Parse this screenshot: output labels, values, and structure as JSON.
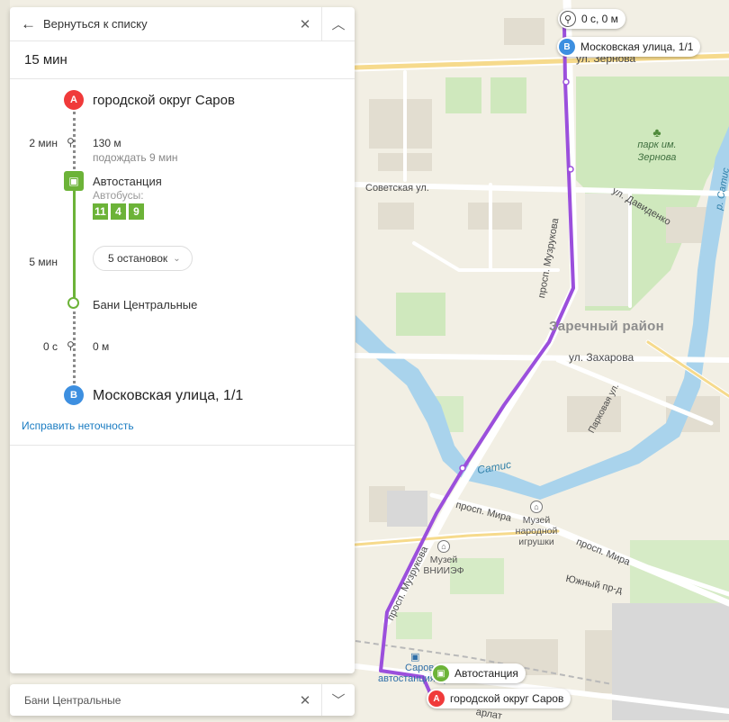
{
  "panel": {
    "back_label": "Вернуться к списку",
    "close_icon": "close-icon",
    "collapse_icon": "chevron-up-icon",
    "duration": "15 мин",
    "route": {
      "start_label": "A",
      "start_name": "городской округ Саров",
      "walk1_time": "2 мин",
      "walk1_distance": "130 м",
      "walk1_wait": "подождать 9 мин",
      "board_stop": "Автостанция",
      "bus_label": "Автобусы:",
      "buses": [
        "11",
        "4",
        "9"
      ],
      "ride_time": "5 мин",
      "stops_button": "5 остановок",
      "exit_stop": "Бани Центральные",
      "walk2_time": "0 с",
      "walk2_distance": "0 м",
      "end_label": "B",
      "end_name": "Московская улица, 1/1"
    },
    "fix_link": "Исправить неточность"
  },
  "bottom_search": {
    "value": "Бани Центральные",
    "close_icon": "close-icon",
    "expand_icon": "chevron-down-icon"
  },
  "map": {
    "route_color": "#9b4fdc",
    "streets": {
      "zernova": "ул. Зернова",
      "sovetskaya": "Советская ул.",
      "davidenko": "ул. Давиденко",
      "muzrukova_top": "просп. Музрукова",
      "muzrukova_bottom": "просп. Музрукова",
      "zakharova": "ул. Захарова",
      "parkovaya": "Парковая ул.",
      "mira_left": "просп. Мира",
      "mira_right": "просп. Мира",
      "yuzhny": "Южный пр-д",
      "satis_right": "р. Сатис",
      "sarlat": "арлат"
    },
    "river_satis": "Сатис",
    "park": [
      "парк им.",
      "Зернова"
    ],
    "district": "Заречный район",
    "museum_toy": [
      "Музей",
      "народной",
      "игрушки"
    ],
    "museum_vniief": [
      "Музей",
      "ВНИИЭФ"
    ],
    "station_name": "Саров",
    "station_sub": "автостанция Тупиковая",
    "pins": {
      "b_walk": "0 с, 0 м",
      "b_label": "B",
      "b_name": "Московская улица, 1/1",
      "bus_stop": "Автостанция",
      "a_label": "A",
      "a_name": "городской округ Саров"
    }
  }
}
